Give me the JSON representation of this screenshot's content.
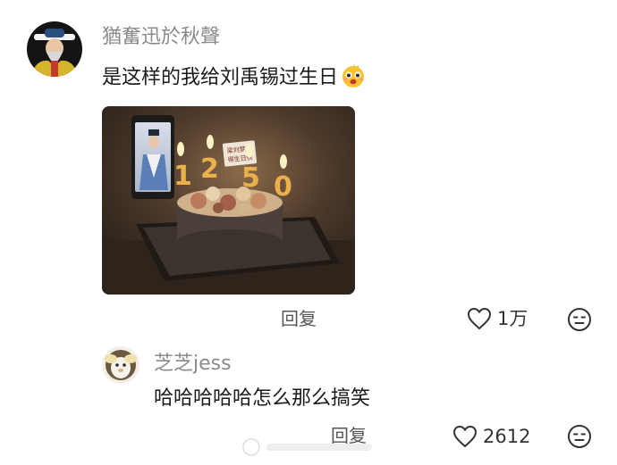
{
  "comments": [
    {
      "username": "猶奮迅於秋聲",
      "text": "是这样的我给刘禹锡过生日",
      "emoji": "face-emoji",
      "image": {
        "cake_label_lines": [
          "梁刘梦",
          "得生日快"
        ],
        "candle_digits": [
          "1",
          "2",
          "5",
          "0"
        ]
      },
      "reply_label": "回复",
      "like_count": "1万",
      "more_icon": "face-neutral-icon"
    },
    {
      "username": "芝芝jess",
      "text": "哈哈哈哈哈怎么那么搞笑",
      "reply_label": "回复",
      "like_count": "2612",
      "more_icon": "face-neutral-icon"
    }
  ],
  "colors": {
    "username": "#8a8a8a",
    "text": "#1a1a1a",
    "secondary": "#555555"
  }
}
